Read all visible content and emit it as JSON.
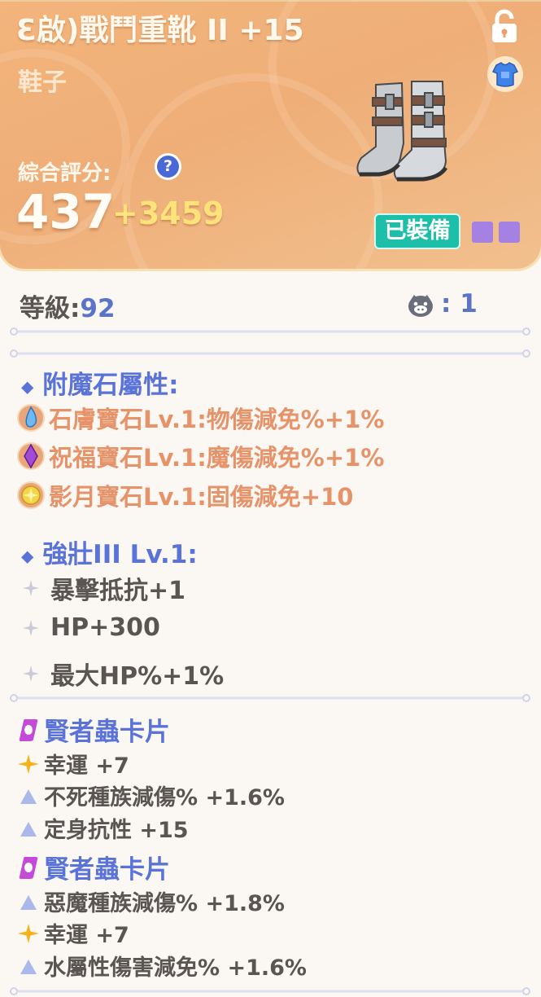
{
  "item": {
    "title": "Ɛ啟)戰鬥重靴 II +15",
    "category": "鞋子",
    "score_label": "綜合評分:",
    "help_glyph": "?",
    "score": "437",
    "score_bonus": "+3459",
    "equipped_label": "已裝備",
    "icons": [
      "lock-icon",
      "armor-icon",
      "boots-icon"
    ],
    "colors": {
      "header": "#efae78",
      "equipped": "#1ebfa8",
      "accent": "#5a73d8",
      "gem_text": "#e6936a"
    }
  },
  "info": {
    "level_label": "等級:",
    "level_value": "92",
    "slot_value": ": 1"
  },
  "enchant": {
    "heading": "附魔石屬性:",
    "gems": [
      {
        "icon": "blue-gem-icon",
        "text": "石膚寶石Lv.1:物傷減免%+1%"
      },
      {
        "icon": "purple-gem-icon",
        "text": "祝福寶石Lv.1:魔傷減免%+1%"
      },
      {
        "icon": "yellow-gem-icon",
        "text": "影月寶石Lv.1:固傷減免+10"
      }
    ]
  },
  "refine": {
    "heading": "強壯III Lv.1:",
    "stats": [
      "暴擊抵抗+1",
      "HP+300",
      "最大HP%+1%"
    ]
  },
  "cards": [
    {
      "name": "賢者蟲卡片",
      "effects": [
        {
          "icon": "gold-star-icon",
          "text": "幸運 +7"
        },
        {
          "icon": "triangle-icon",
          "text": "不死種族減傷% +1.6%"
        },
        {
          "icon": "triangle-icon",
          "text": "定身抗性 +15"
        }
      ]
    },
    {
      "name": "賢者蟲卡片",
      "effects": [
        {
          "icon": "triangle-icon",
          "text": "惡魔種族減傷% +1.8%"
        },
        {
          "icon": "gold-star-icon",
          "text": "幸運 +7"
        },
        {
          "icon": "triangle-icon",
          "text": "水屬性傷害減免% +1.6%"
        }
      ]
    }
  ]
}
